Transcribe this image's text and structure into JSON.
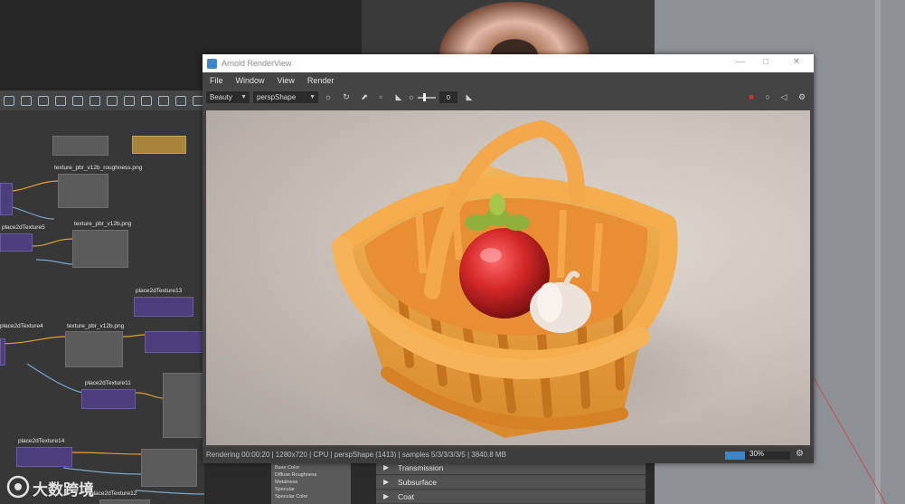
{
  "window": {
    "title": "Arnold RenderView",
    "controls": {
      "minimize": "—",
      "maximize": "□",
      "close": "✕"
    }
  },
  "menu": [
    "File",
    "Window",
    "View",
    "Render"
  ],
  "toolbar": {
    "aov_select": "Beauty",
    "camera_select": "perspShape",
    "exposure_value": "0",
    "icons": [
      "sun-icon",
      "refresh-icon",
      "crop-icon",
      "snapshot-icon",
      "channel-icon",
      "gamma-icon",
      "stop-icon",
      "rgb-icon",
      "sound-icon",
      "settings-icon"
    ]
  },
  "status": {
    "text": "Rendering 00:00:20 | 1280x720 | CPU | perspShape (1413) | samples 5/3/3/3/3/5 | 3840.8 MB",
    "progress": 30,
    "progress_label": "30%"
  },
  "attributes": {
    "rows": [
      "Transmission",
      "Subsurface",
      "Coat"
    ],
    "list": [
      "Base Color",
      "Diffuse Roughness",
      "Metalness",
      "Specular",
      "Specular Color"
    ]
  },
  "nodes": [
    "texture_pbr_v12b_roughness.png",
    "texture_pbr_v12b.png",
    "texture_pbr_v12b.png",
    "place2dTexture5",
    "place2dTexture13",
    "place2dTexture4",
    "place2dTexture14",
    "place2dTexture12",
    "place2dTexture11"
  ],
  "watermark": "大数跨境",
  "colors": {
    "progress": "#3d84c9",
    "node_purple": "#4d3f7d",
    "wire_orange": "#e0a030",
    "wire_blue": "#7aa6c8",
    "basket": "#f0a448"
  }
}
